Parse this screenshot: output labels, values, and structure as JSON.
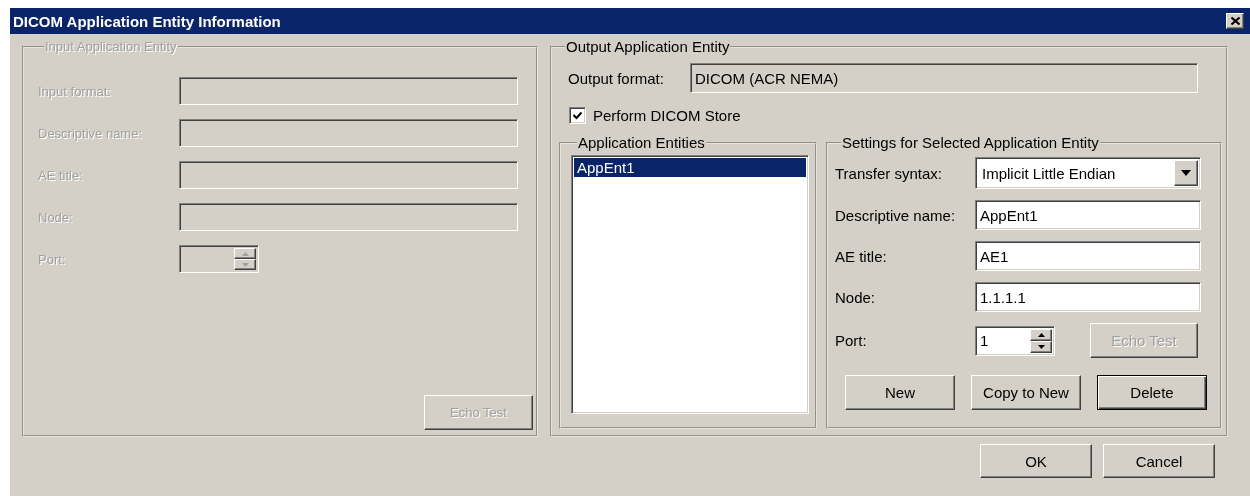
{
  "window": {
    "title": "DICOM Application Entity Information"
  },
  "input_entity": {
    "title": "Input Application Entity",
    "disabled": true,
    "fields": [
      {
        "label": "Input format:"
      },
      {
        "label": "Descriptive name:"
      },
      {
        "label": "AE title:"
      },
      {
        "label": "Node:"
      }
    ],
    "port": {
      "label": "Port:"
    },
    "echo_button": {
      "label": "Echo Test"
    }
  },
  "output_entity": {
    "title": "Output Application Entity",
    "output_format": {
      "label": "Output format:",
      "value": "DICOM (ACR NEMA)"
    },
    "perform_store": {
      "label": "Perform DICOM Store",
      "checked": true
    },
    "application_entities": {
      "title": "Application Entities",
      "items": [
        {
          "label": "AppEnt1",
          "selected": true
        }
      ]
    },
    "settings": {
      "title": "Settings for Selected Application Entity",
      "transfer_syntax": {
        "label": "Transfer syntax:",
        "value": "Implicit Little Endian"
      },
      "fields": [
        {
          "label": "Descriptive name:",
          "value": "AppEnt1"
        },
        {
          "label": "AE title:",
          "value": "AE1"
        },
        {
          "label": "Node:",
          "value": "1.1.1.1"
        }
      ],
      "port": {
        "label": "Port:",
        "value": "1"
      },
      "echo_button": {
        "label": "Echo Test",
        "disabled": true
      },
      "buttons": [
        {
          "label": "New",
          "default": false
        },
        {
          "label": "Copy to New",
          "default": false
        },
        {
          "label": "Delete",
          "default": true
        }
      ]
    }
  },
  "buttons": [
    {
      "label": "OK"
    },
    {
      "label": "Cancel"
    }
  ]
}
